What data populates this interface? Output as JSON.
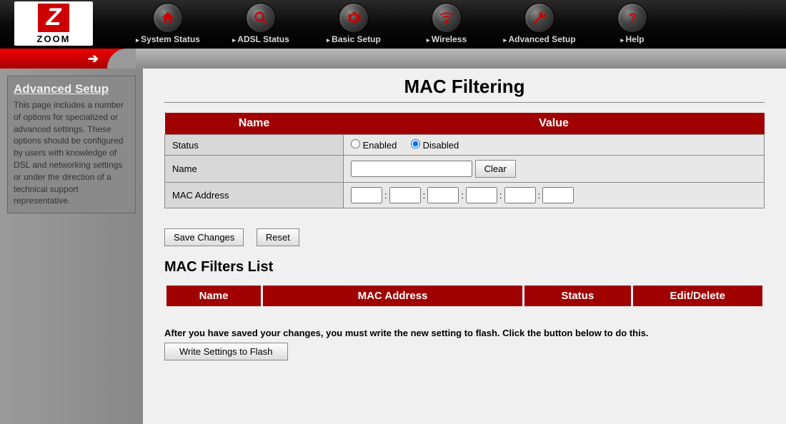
{
  "logo": {
    "letter": "Z",
    "text": "ZOOM"
  },
  "nav": [
    {
      "label": "System Status",
      "icon": "home"
    },
    {
      "label": "ADSL Status",
      "icon": "search"
    },
    {
      "label": "Basic Setup",
      "icon": "gear"
    },
    {
      "label": "Wireless",
      "icon": "wifi"
    },
    {
      "label": "Advanced Setup",
      "icon": "wrench"
    },
    {
      "label": "Help",
      "icon": "help"
    }
  ],
  "sidebar": {
    "title": "Advanced Setup",
    "text": "This page includes a number of options for specialized or advanced settings. These options should be configured by users with knowledge of DSL and networking settings or under the direction of a technical support representative."
  },
  "page": {
    "title": "MAC Filtering",
    "headers": {
      "name": "Name",
      "value": "Value"
    },
    "rows": {
      "status_label": "Status",
      "status_enabled": "Enabled",
      "status_disabled": "Disabled",
      "status_selected": "disabled",
      "name_label": "Name",
      "name_value": "",
      "clear_btn": "Clear",
      "mac_label": "MAC Address",
      "mac_segments": [
        "",
        "",
        "",
        "",
        "",
        ""
      ]
    },
    "buttons": {
      "save": "Save Changes",
      "reset": "Reset"
    },
    "list": {
      "title": "MAC Filters List",
      "headers": {
        "name": "Name",
        "mac": "MAC Address",
        "status": "Status",
        "edit": "Edit/Delete"
      }
    },
    "flash_note": "After you have saved your changes, you must write the new setting to flash. Click the button below to do this.",
    "flash_btn": "Write Settings to Flash"
  }
}
